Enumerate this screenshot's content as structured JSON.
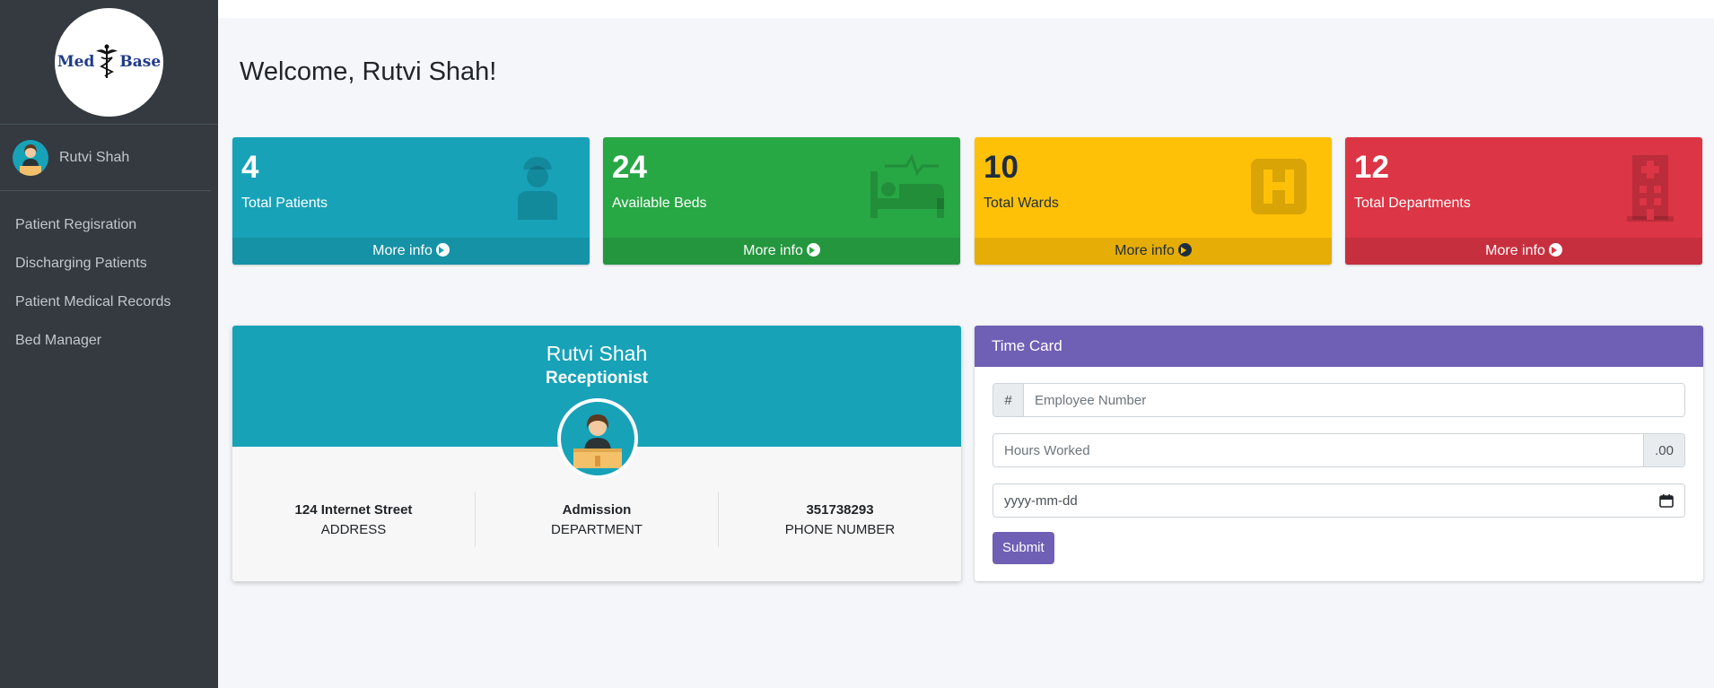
{
  "sidebar": {
    "logo": "Med Base",
    "logo_left": "Med",
    "logo_right": "Base",
    "user_name": "Rutvi Shah",
    "items": [
      {
        "label": "Patient Regisration"
      },
      {
        "label": "Discharging Patients"
      },
      {
        "label": "Patient Medical Records"
      },
      {
        "label": "Bed Manager"
      }
    ]
  },
  "main": {
    "welcome": "Welcome, Rutvi Shah!"
  },
  "boxes": [
    {
      "value": "4",
      "label": "Total Patients",
      "footer": "More info",
      "icon": "patient-icon",
      "color": "#17a2b8"
    },
    {
      "value": "24",
      "label": "Available Beds",
      "footer": "More info",
      "icon": "bed-icon",
      "color": "#28a745"
    },
    {
      "value": "10",
      "label": "Total Wards",
      "footer": "More info",
      "icon": "hospital-sign-icon",
      "color": "#ffc107"
    },
    {
      "value": "12",
      "label": "Total Departments",
      "footer": "More info",
      "icon": "hospital-building-icon",
      "color": "#dc3545"
    }
  ],
  "profile": {
    "name": "Rutvi Shah",
    "role": "Receptionist",
    "stats": [
      {
        "value": "124 Internet Street",
        "key": "ADDRESS"
      },
      {
        "value": "Admission",
        "key": "DEPARTMENT"
      },
      {
        "value": "351738293",
        "key": "PHONE NUMBER"
      }
    ]
  },
  "timecard": {
    "title": "Time Card",
    "employee_prefix": "#",
    "employee_placeholder": "Employee Number",
    "hours_placeholder": "Hours Worked",
    "hours_suffix": ".00",
    "date_placeholder": "yyyy-mm-dd",
    "submit_label": "Submit"
  },
  "colors": {
    "sidebar": "#343a40",
    "info": "#17a2b8",
    "success": "#28a745",
    "warning": "#ffc107",
    "danger": "#dc3545",
    "purple": "#6f5fb5"
  }
}
